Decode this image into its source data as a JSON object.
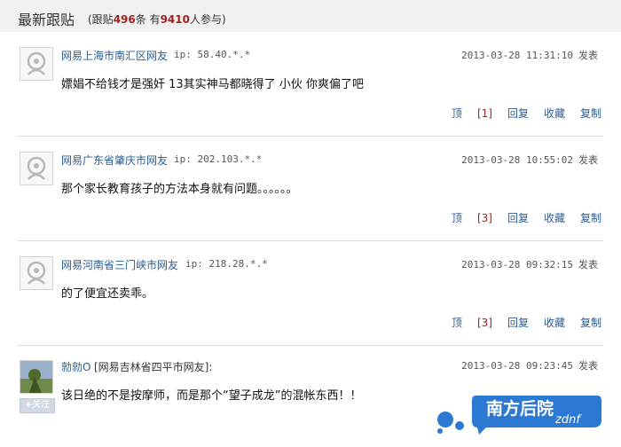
{
  "header": {
    "title": "最新跟贴",
    "stats_prefix": "(跟贴",
    "posts_count": "496",
    "stats_mid": "条  有",
    "participants": "9410",
    "stats_suffix": "人参与)"
  },
  "posts": [
    {
      "user": "网易上海市南汇区网友",
      "ip": "ip: 58.40.*.*",
      "time": "2013-03-28 11:31:10",
      "publish": "发表",
      "content": "嫖娼不给钱才是强奸  13其实神马都晓得了  小伙  你爽偏了吧",
      "up_label": "顶",
      "up_count": "[1]",
      "reply": "回复",
      "collect": "收藏",
      "copy": "复制"
    },
    {
      "user": "网易广东省肇庆市网友",
      "ip": "ip: 202.103.*.*",
      "time": "2013-03-28 10:55:02",
      "publish": "发表",
      "content": "那个家长教育孩子的方法本身就有问题。。。。。。",
      "up_label": "顶",
      "up_count": "[3]",
      "reply": "回复",
      "collect": "收藏",
      "copy": "复制"
    },
    {
      "user": "网易河南省三门峡市网友",
      "ip": "ip: 218.28.*.*",
      "time": "2013-03-28 09:32:15",
      "publish": "发表",
      "content": "的了便宜还卖乖。",
      "up_label": "顶",
      "up_count": "[3]",
      "reply": "回复",
      "collect": "收藏",
      "copy": "复制"
    },
    {
      "user": "勍勍O",
      "location": "[网易吉林省四平市网友]:",
      "time": "2013-03-28 09:23:45",
      "publish": "发表",
      "content": "该日绝的不是按摩师，而是那个“望子成龙”的混帐东西！！",
      "follow": "关注"
    }
  ],
  "watermark": {
    "text": "南方后院",
    "sub": "zdnf"
  }
}
